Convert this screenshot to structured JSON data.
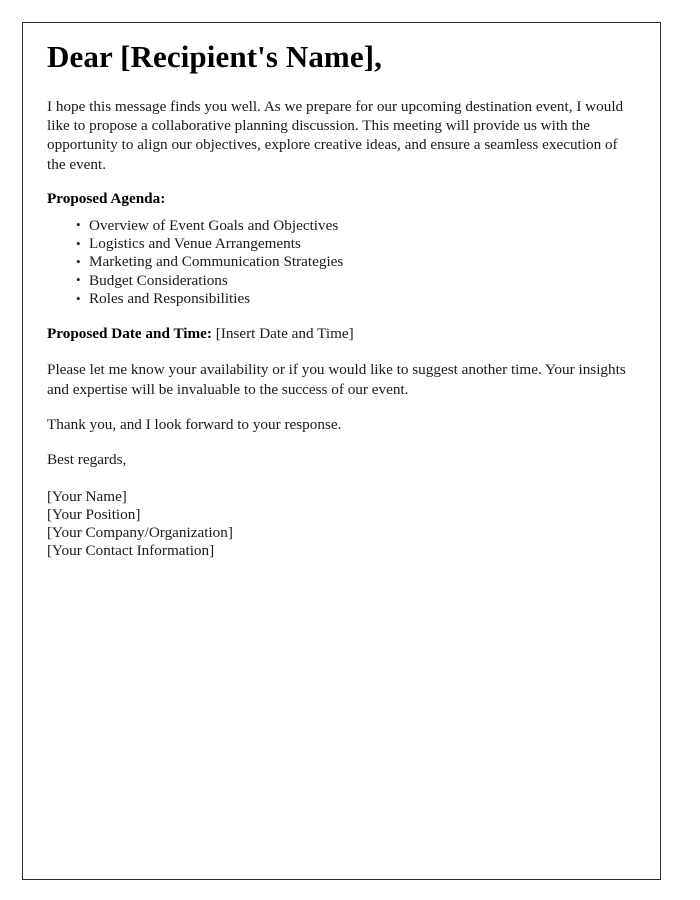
{
  "document": {
    "heading": "Dear [Recipient's Name],",
    "intro_paragraph": "I hope this message finds you well. As we prepare for our upcoming destination event, I would like to propose a collaborative planning discussion. This meeting will provide us with the opportunity to align our objectives, explore creative ideas, and ensure a seamless execution of the event.",
    "agenda": {
      "label": "Proposed Agenda:",
      "items": [
        "Overview of Event Goals and Objectives",
        "Logistics and Venue Arrangements",
        "Marketing and Communication Strategies",
        "Budget Considerations",
        "Roles and Responsibilities"
      ]
    },
    "datetime": {
      "label": "Proposed Date and Time:",
      "value": "[Insert Date and Time]"
    },
    "availability_paragraph": "Please let me know your availability or if you would like to suggest another time. Your insights and expertise will be invaluable to the success of our event.",
    "thanks_paragraph": "Thank you, and I look forward to your response.",
    "signoff": "Best regards,",
    "signature": [
      "[Your Name]",
      "[Your Position]",
      "[Your Company/Organization]",
      "[Your Contact Information]"
    ]
  }
}
